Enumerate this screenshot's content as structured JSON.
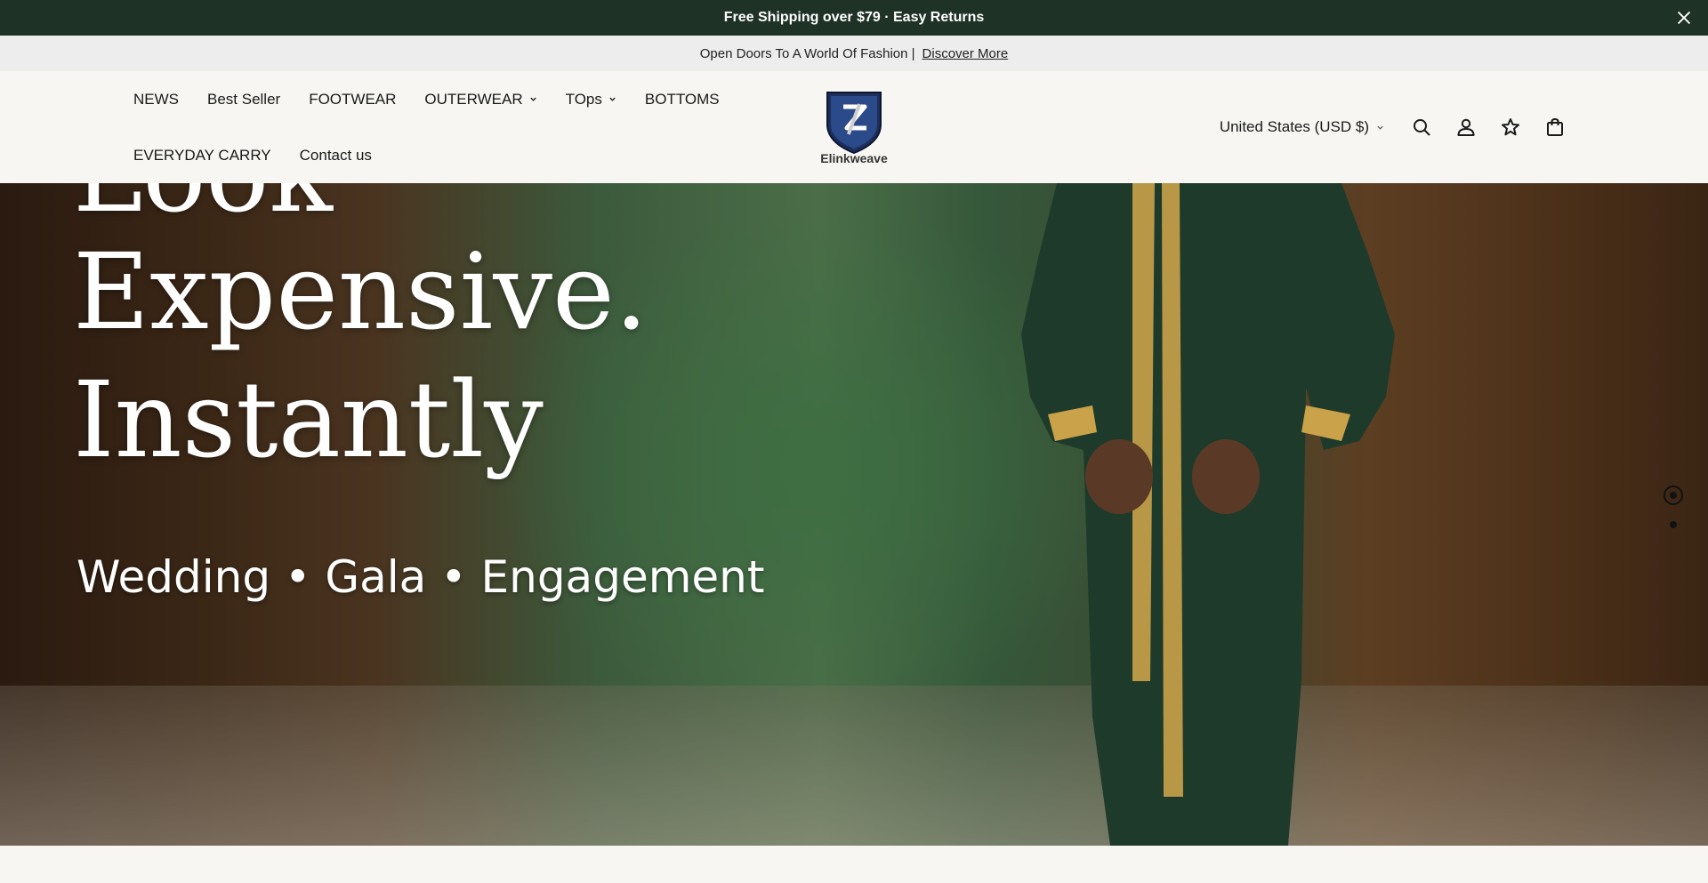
{
  "announcement": {
    "text": "Free Shipping over $79 · Easy Returns",
    "close_icon": "close-icon"
  },
  "subbar": {
    "text": "Open Doors To A World Of Fashion |",
    "link": "Discover More"
  },
  "nav": {
    "items": [
      {
        "label": "NEWS",
        "dropdown": false
      },
      {
        "label": "Best Seller",
        "dropdown": false
      },
      {
        "label": "FOOTWEAR",
        "dropdown": false
      },
      {
        "label": "OUTERWEAR",
        "dropdown": true
      },
      {
        "label": "TOps",
        "dropdown": true
      },
      {
        "label": "BOTTOMS",
        "dropdown": false
      },
      {
        "label": "EVERYDAY CARRY",
        "dropdown": false
      },
      {
        "label": "Contact us",
        "dropdown": false
      }
    ]
  },
  "logo": {
    "text": "Elinkweave"
  },
  "tools": {
    "country": "United States (USD $)",
    "icons": [
      "search-icon",
      "account-icon",
      "wishlist-star-icon",
      "cart-bag-icon"
    ]
  },
  "hero": {
    "headline_lines": [
      "Look",
      "Expensive.",
      "Instantly"
    ],
    "tagline": "Wedding • Gala • Engagement",
    "slides": 2,
    "active_slide": 1
  },
  "colors": {
    "announcement_bg": "#1f3226",
    "page_bg": "#f7f6f2",
    "subbar_bg": "#ededed",
    "coat_green": "#1e3a2a",
    "gold": "#c9a24a"
  }
}
